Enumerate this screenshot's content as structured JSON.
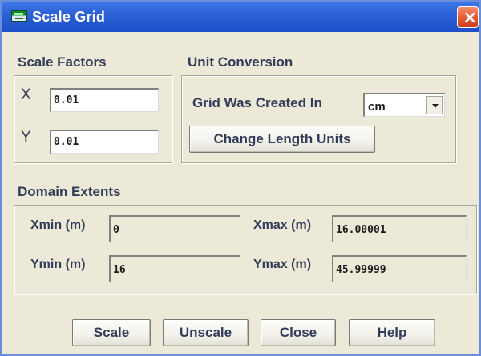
{
  "window": {
    "title": "Scale Grid",
    "close_label": "×"
  },
  "scale_factors": {
    "label": "Scale Factors",
    "x_label": "X",
    "x_value": "0.01",
    "y_label": "Y",
    "y_value": "0.01"
  },
  "unit_conversion": {
    "label": "Unit Conversion",
    "grid_created_label": "Grid Was Created In",
    "grid_unit": "cm",
    "change_units_button": "Change Length Units"
  },
  "domain_extents": {
    "label": "Domain Extents",
    "xmin_label": "Xmin (m)",
    "xmin_value": "0",
    "xmax_label": "Xmax (m)",
    "xmax_value": "16.00001",
    "ymin_label": "Ymin (m)",
    "ymin_value": "16",
    "ymax_label": "Ymax (m)",
    "ymax_value": "45.99999"
  },
  "buttons": {
    "scale": "Scale",
    "unscale": "Unscale",
    "close": "Close",
    "help": "Help"
  }
}
